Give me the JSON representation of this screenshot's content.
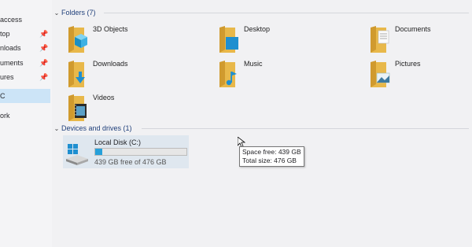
{
  "nav": {
    "items": [
      {
        "label": "access",
        "pinned": false,
        "selected": false
      },
      {
        "label": "top",
        "pinned": true,
        "selected": false
      },
      {
        "label": "nloads",
        "pinned": true,
        "selected": false
      },
      {
        "label": "uments",
        "pinned": true,
        "selected": false
      },
      {
        "label": "ures",
        "pinned": true,
        "selected": false
      },
      {
        "label": "C",
        "pinned": false,
        "selected": true
      },
      {
        "label": "ork",
        "pinned": false,
        "selected": false
      }
    ],
    "pin_glyph": "📌"
  },
  "folders": {
    "header": "Folders (7)",
    "items": [
      {
        "name": "3D Objects",
        "icon": "3d-objects-icon"
      },
      {
        "name": "Desktop",
        "icon": "desktop-icon"
      },
      {
        "name": "Documents",
        "icon": "documents-icon"
      },
      {
        "name": "Downloads",
        "icon": "downloads-icon"
      },
      {
        "name": "Music",
        "icon": "music-icon"
      },
      {
        "name": "Pictures",
        "icon": "pictures-icon"
      },
      {
        "name": "Videos",
        "icon": "videos-icon"
      }
    ]
  },
  "devices": {
    "header": "Devices and drives (1)",
    "drive": {
      "name": "Local Disk (C:)",
      "free_text": "439 GB free of 476 GB",
      "used_fraction": 0.078,
      "icon": "hard-drive-icon"
    },
    "tooltip": {
      "line1": "Space free: 439 GB",
      "line2": "Total size: 476 GB"
    }
  },
  "colors": {
    "folder": "#e8b84a",
    "accent": "#26a0da",
    "selected_bg": "#cce4f7",
    "header_text": "#1f3f7a"
  }
}
